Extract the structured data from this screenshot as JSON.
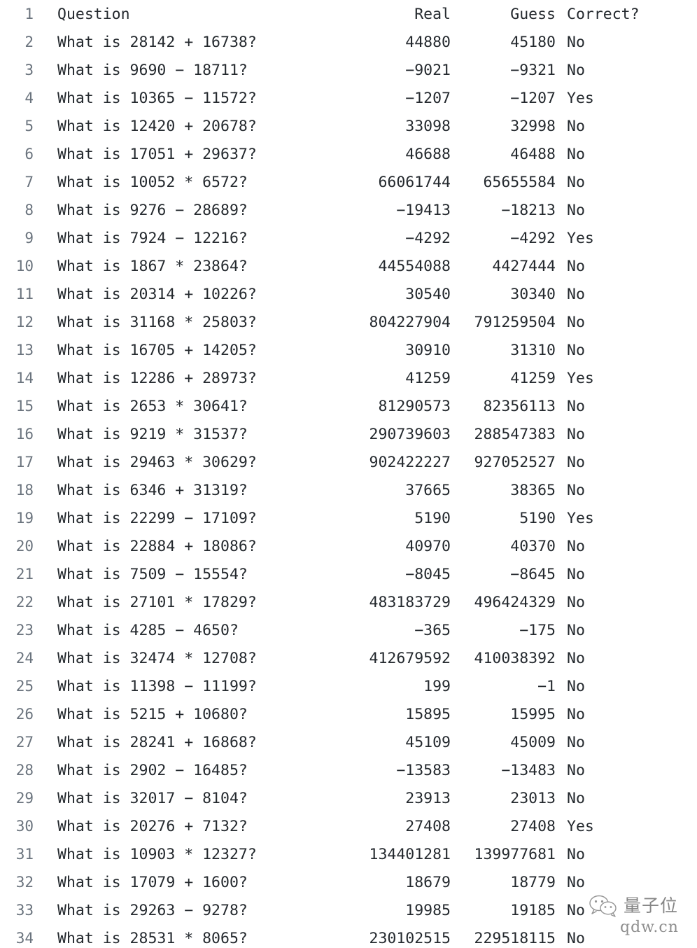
{
  "view": {
    "type": "code-table-listing",
    "background_color": "#ffffff",
    "text_color": "#24292e",
    "line_number_color": "#6a737d"
  },
  "columns": {
    "question": "Question",
    "real": "Real",
    "guess": "Guess",
    "correct": "Correct?"
  },
  "rows": [
    {
      "line": "1",
      "question": "Question",
      "real": "Real",
      "guess": "Guess",
      "correct": "Correct?",
      "header": true
    },
    {
      "line": "2",
      "question": "What is 28142 + 16738?",
      "real": "44880",
      "guess": "45180",
      "correct": "No"
    },
    {
      "line": "3",
      "question": "What is 9690 − 18711?",
      "real": "−9021",
      "guess": "−9321",
      "correct": "No"
    },
    {
      "line": "4",
      "question": "What is 10365 − 11572?",
      "real": "−1207",
      "guess": "−1207",
      "correct": "Yes"
    },
    {
      "line": "5",
      "question": "What is 12420 + 20678?",
      "real": "33098",
      "guess": "32998",
      "correct": "No"
    },
    {
      "line": "6",
      "question": "What is 17051 + 29637?",
      "real": "46688",
      "guess": "46488",
      "correct": "No"
    },
    {
      "line": "7",
      "question": "What is 10052 * 6572?",
      "real": "66061744",
      "guess": "65655584",
      "correct": "No"
    },
    {
      "line": "8",
      "question": "What is 9276 − 28689?",
      "real": "−19413",
      "guess": "−18213",
      "correct": "No"
    },
    {
      "line": "9",
      "question": "What is 7924 − 12216?",
      "real": "−4292",
      "guess": "−4292",
      "correct": "Yes"
    },
    {
      "line": "10",
      "question": "What is 1867 * 23864?",
      "real": "44554088",
      "guess": "4427444",
      "correct": "No"
    },
    {
      "line": "11",
      "question": "What is 20314 + 10226?",
      "real": "30540",
      "guess": "30340",
      "correct": "No"
    },
    {
      "line": "12",
      "question": "What is 31168 * 25803?",
      "real": "804227904",
      "guess": "791259504",
      "correct": "No"
    },
    {
      "line": "13",
      "question": "What is 16705 + 14205?",
      "real": "30910",
      "guess": "31310",
      "correct": "No"
    },
    {
      "line": "14",
      "question": "What is 12286 + 28973?",
      "real": "41259",
      "guess": "41259",
      "correct": "Yes"
    },
    {
      "line": "15",
      "question": "What is 2653 * 30641?",
      "real": "81290573",
      "guess": "82356113",
      "correct": "No"
    },
    {
      "line": "16",
      "question": "What is 9219 * 31537?",
      "real": "290739603",
      "guess": "288547383",
      "correct": "No"
    },
    {
      "line": "17",
      "question": "What is 29463 * 30629?",
      "real": "902422227",
      "guess": "927052527",
      "correct": "No"
    },
    {
      "line": "18",
      "question": "What is 6346 + 31319?",
      "real": "37665",
      "guess": "38365",
      "correct": "No"
    },
    {
      "line": "19",
      "question": "What is 22299 − 17109?",
      "real": "5190",
      "guess": "5190",
      "correct": "Yes"
    },
    {
      "line": "20",
      "question": "What is 22884 + 18086?",
      "real": "40970",
      "guess": "40370",
      "correct": "No"
    },
    {
      "line": "21",
      "question": "What is 7509 − 15554?",
      "real": "−8045",
      "guess": "−8645",
      "correct": "No"
    },
    {
      "line": "22",
      "question": "What is 27101 * 17829?",
      "real": "483183729",
      "guess": "496424329",
      "correct": "No"
    },
    {
      "line": "23",
      "question": "What is 4285 − 4650?",
      "real": "−365",
      "guess": "−175",
      "correct": "No"
    },
    {
      "line": "24",
      "question": "What is 32474 * 12708?",
      "real": "412679592",
      "guess": "410038392",
      "correct": "No"
    },
    {
      "line": "25",
      "question": "What is 11398 − 11199?",
      "real": "199",
      "guess": "−1",
      "correct": "No"
    },
    {
      "line": "26",
      "question": "What is 5215 + 10680?",
      "real": "15895",
      "guess": "15995",
      "correct": "No"
    },
    {
      "line": "27",
      "question": "What is 28241 + 16868?",
      "real": "45109",
      "guess": "45009",
      "correct": "No"
    },
    {
      "line": "28",
      "question": "What is 2902 − 16485?",
      "real": "−13583",
      "guess": "−13483",
      "correct": "No"
    },
    {
      "line": "29",
      "question": "What is 32017 − 8104?",
      "real": "23913",
      "guess": "23013",
      "correct": "No"
    },
    {
      "line": "30",
      "question": "What is 20276 + 7132?",
      "real": "27408",
      "guess": "27408",
      "correct": "Yes"
    },
    {
      "line": "31",
      "question": "What is 10903 * 12327?",
      "real": "134401281",
      "guess": "139977681",
      "correct": "No"
    },
    {
      "line": "32",
      "question": "What is 17079 + 1600?",
      "real": "18679",
      "guess": "18779",
      "correct": "No"
    },
    {
      "line": "33",
      "question": "What is 29263 − 9278?",
      "real": "19985",
      "guess": "19185",
      "correct": "No"
    },
    {
      "line": "34",
      "question": "What is 28531 * 8065?",
      "real": "230102515",
      "guess": "229518115",
      "correct": "No"
    }
  ],
  "watermark": {
    "icon": "wechat-icon",
    "name": "量子位",
    "url": "qdw.cn"
  }
}
